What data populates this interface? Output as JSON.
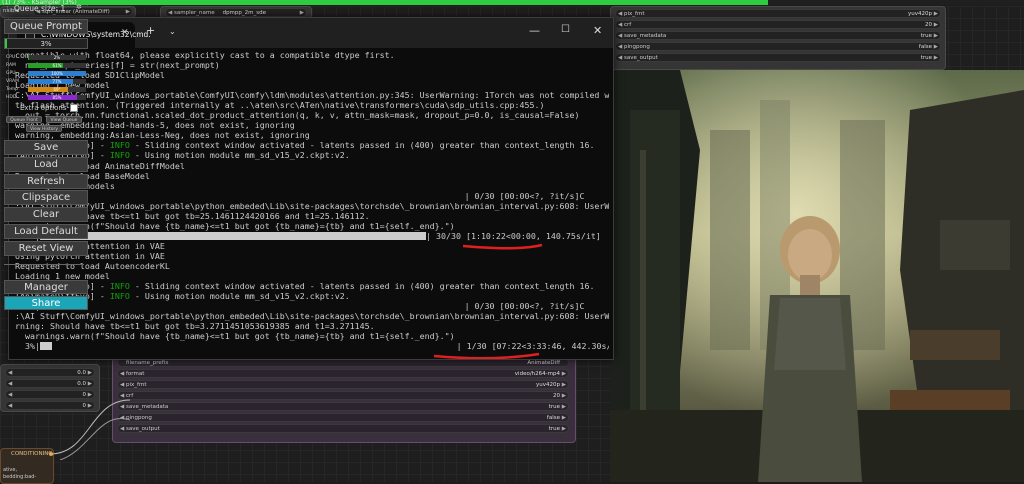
{
  "window": {
    "tab_title": "(1) 73% - KSampler (3%)",
    "progress_fraction": 0.75
  },
  "top_nodes": {
    "left_frag": "nsible",
    "left_widget": "sqrt_linear (AnimateDiff)",
    "sampler_label": "sampler_name",
    "sampler_value": "dpmpp_2m_sde"
  },
  "right_node_top": {
    "rows": [
      {
        "label": "pix_fmt",
        "value": "yuv420p"
      },
      {
        "label": "crf",
        "value": "20"
      },
      {
        "label": "save_metadata",
        "value": "true"
      },
      {
        "label": "pingpong",
        "value": "false"
      },
      {
        "label": "save_output",
        "value": "true"
      }
    ]
  },
  "terminal": {
    "title": "C:\\WINDOWS\\system32\\cmd.",
    "lines": [
      {
        "t": "compatible with float64, please explicitly cast to a compatible dtype first."
      },
      {
        "t": "  nxt_prompt_series[f] = str(next_prompt)"
      },
      {
        "t": "Requested to load SD1ClipModel"
      },
      {
        "t": "Loading 1 new model"
      },
      {
        "t": "C:\\AI Stuff\\ComfyUI_windows_portable\\ComfyUI\\comfy\\ldm\\modules\\attention.py:345: UserWarning: 1Torch was not compiled wi"
      },
      {
        "t": "th flash attention. (Triggered internally at ..\\aten\\src\\ATen\\native\\transformers\\cuda\\sdp_utils.cpp:455.)"
      },
      {
        "t": "  out = torch.nn.functional.scaled_dot_product_attention(q, k, v, attn_mask=mask, dropout_p=0.0, is_causal=False)"
      },
      {
        "t": "warning, embedding:bad-hands-5, does not exist, ignoring"
      },
      {
        "t": "warning, embedding:Asian-Less-Neg, does not exist, ignoring"
      },
      {
        "a": "[AnimateDiffEvo] - ",
        "g": "INFO",
        "b": " - Sliding context window activated - latents passed in (400) greater than context_length 16."
      },
      {
        "a": "[AnimateDiffEvo] - ",
        "g": "INFO",
        "b": " - Using motion module mm_sd_v15_v2.ckpt:v2."
      },
      {
        "t": "Requested to load AnimateDiffModel"
      },
      {
        "t": "Requested to load BaseModel"
      },
      {
        "t": "Loading 2 new models"
      },
      {
        "t": "  0%|                                                                                     | 0/30 [00:00<?, ?it/s]C"
      },
      {
        "t": ":\\AI Stuff\\ComfyUI_windows_portable\\python_embeded\\Lib\\site-packages\\torchsde\\_brownian\\brownian_interval.py:608: UserWa"
      },
      {
        "t": "rning: Should have tb<=t1 but got tb=25.1461124420166 and t1=25.146112."
      },
      {
        "t": "  warnings.warn(f\"Should have {tb_name}<=t1 but got {tb_name}={tb} and t1={self._end}.\")"
      },
      {
        "pre": "100%|",
        "barw": 386,
        "post": "| 30/30 ",
        "hl": "[1:10:22<00:00,",
        "tail": " 140.75s/it]"
      },
      {
        "t": "Using pytorch attention in VAE"
      },
      {
        "t": "Using pytorch attention in VAE"
      },
      {
        "t": "Requested to load AutoencoderKL"
      },
      {
        "t": "Loading 1 new model"
      },
      {
        "a": "[AnimateDiffEvo] - ",
        "g": "INFO",
        "b": " - Sliding context window activated - latents passed in (400) greater than context_length 16."
      },
      {
        "a": "[AnimateDiffEvo] - ",
        "g": "INFO",
        "b": " - Using motion module mm_sd_v15_v2.ckpt:v2."
      },
      {
        "t": "  0%|                                                                                     | 0/30 [00:00<?, ?it/s]C"
      },
      {
        "t": ":\\AI Stuff\\ComfyUI_windows_portable\\python_embeded\\Lib\\site-packages\\torchsde\\_brownian\\brownian_interval.py:608: UserWa"
      },
      {
        "t": "rning: Should have tb<=t1 but got tb=3.2711451053619385 and t1=3.271145."
      },
      {
        "t": "  warnings.warn(f\"Should have {tb_name}<=t1 but got {tb_name}={tb} and t1={self._end}.\")"
      },
      {
        "pre": "  3%|",
        "barw": 12,
        "post": "                                                                                 | 1/30 ",
        "hl": "[07:22<3:33:46,",
        "tail": " 442.30s/it]"
      }
    ]
  },
  "bottom_node": {
    "filename_label": "filename_prefix",
    "filename_value": "AnimateDiff",
    "rows": [
      {
        "label": "format",
        "value": "video/h264-mp4"
      },
      {
        "label": "pix_fmt",
        "value": "yuv420p"
      },
      {
        "label": "crf",
        "value": "20"
      },
      {
        "label": "save_metadata",
        "value": "true"
      },
      {
        "label": "pingpong",
        "value": "false"
      },
      {
        "label": "save_output",
        "value": "true"
      }
    ]
  },
  "left_widgets": [
    "0.0",
    "0.0",
    "0",
    "0"
  ],
  "conditioning": {
    "title": "CONDITIONING",
    "text1": "ative,",
    "text2": "bedding:bad-"
  },
  "queue_panel": {
    "title": "Queue size: 1",
    "queue_prompt": "Queue Prompt",
    "progress": "3%",
    "progress_fraction": 0.03,
    "stats": [
      {
        "label": "CPU",
        "value": "2%",
        "fraction": 0.02,
        "color": "#2a9d2a"
      },
      {
        "label": "RAM",
        "value": "61%",
        "fraction": 0.61,
        "color": "#2a9d2a"
      },
      {
        "label": "GPU",
        "value": "100%",
        "fraction": 1.0,
        "color": "#2f7fd1"
      },
      {
        "label": "VRAM",
        "value": "77%",
        "fraction": 0.77,
        "color": "#2f7fd1"
      },
      {
        "label": "Temp",
        "value": "69°",
        "fraction": 0.69,
        "color": "#d48a1a"
      },
      {
        "label": "HDD",
        "value": "85%",
        "fraction": 0.85,
        "color": "#8a2bd1"
      }
    ],
    "extra_options": "Extra options",
    "queue_front": "Queue Front",
    "view_queue": "View Queue",
    "view_history": "View History",
    "buttons": [
      "Save",
      "Load",
      "Refresh",
      "Clipspace",
      "Clear",
      "Load Default",
      "Reset View"
    ],
    "manager": "Manager",
    "share": "Share",
    "accent": "#1aa6b8"
  }
}
